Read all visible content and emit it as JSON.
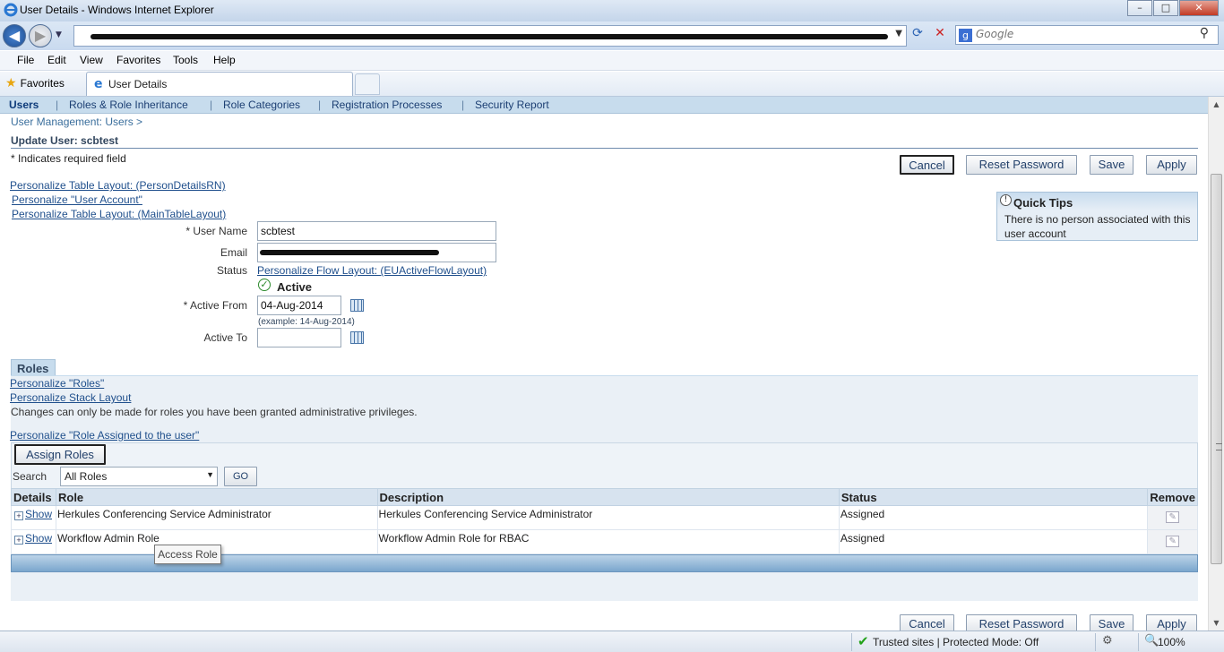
{
  "window": {
    "title": "User Details - Windows Internet Explorer",
    "min": "–",
    "max": "□",
    "close": "✕"
  },
  "nav": {
    "search_placeholder": "Google"
  },
  "menu": [
    "File",
    "Edit",
    "View",
    "Favorites",
    "Tools",
    "Help"
  ],
  "favorites": {
    "label": "Favorites",
    "tab_label": "User Details"
  },
  "subtabs": [
    "Users",
    "Roles & Role Inheritance",
    "Role Categories",
    "Registration Processes",
    "Security Report"
  ],
  "breadcrumb": "User Management: Users  >",
  "header": {
    "title": "Update User: scbtest",
    "required_note": "* Indicates required field"
  },
  "buttons": {
    "cancel": "Cancel",
    "reset": "Reset Password",
    "save": "Save",
    "apply": "Apply"
  },
  "personalize": {
    "table_person": "Personalize Table Layout: (PersonDetailsRN)",
    "user_account": "Personalize \"User Account\"",
    "table_main": "Personalize Table Layout: (MainTableLayout)",
    "flow_status": "Personalize Flow Layout: (EUActiveFlowLayout)",
    "roles": "Personalize \"Roles\"",
    "stack": "Personalize Stack Layout",
    "role_assigned": "Personalize \"Role Assigned to the user\""
  },
  "form": {
    "username_label": "* User Name",
    "username_value": "scbtest",
    "email_label": "Email",
    "status_label": "Status",
    "status_value": "Active",
    "active_from_label": "* Active From",
    "active_from_value": "04-Aug-2014",
    "active_from_hint": "(example: 14-Aug-2014)",
    "active_to_label": "Active To",
    "active_to_value": ""
  },
  "tips": {
    "title": "Quick Tips",
    "body": "There is no person associated with this user account"
  },
  "roles": {
    "tab": "Roles",
    "note": "Changes can only be made for roles you have been granted administrative privileges.",
    "assign_button": "Assign Roles",
    "search_label": "Search",
    "search_value": "All Roles",
    "go": "GO",
    "columns": [
      "Details",
      "Role",
      "Description",
      "Status",
      "Remove"
    ],
    "rows": [
      {
        "details": "Show",
        "role": "Herkules Conferencing Service Administrator",
        "description": "Herkules Conferencing Service Administrator",
        "status": "Assigned"
      },
      {
        "details": "Show",
        "role": "Workflow Admin Role",
        "description": "Workflow Admin Role for RBAC",
        "status": "Assigned"
      }
    ]
  },
  "tooltip": "Access Role",
  "status": {
    "zone": "Trusted sites | Protected Mode: Off",
    "zoom": "100%"
  }
}
